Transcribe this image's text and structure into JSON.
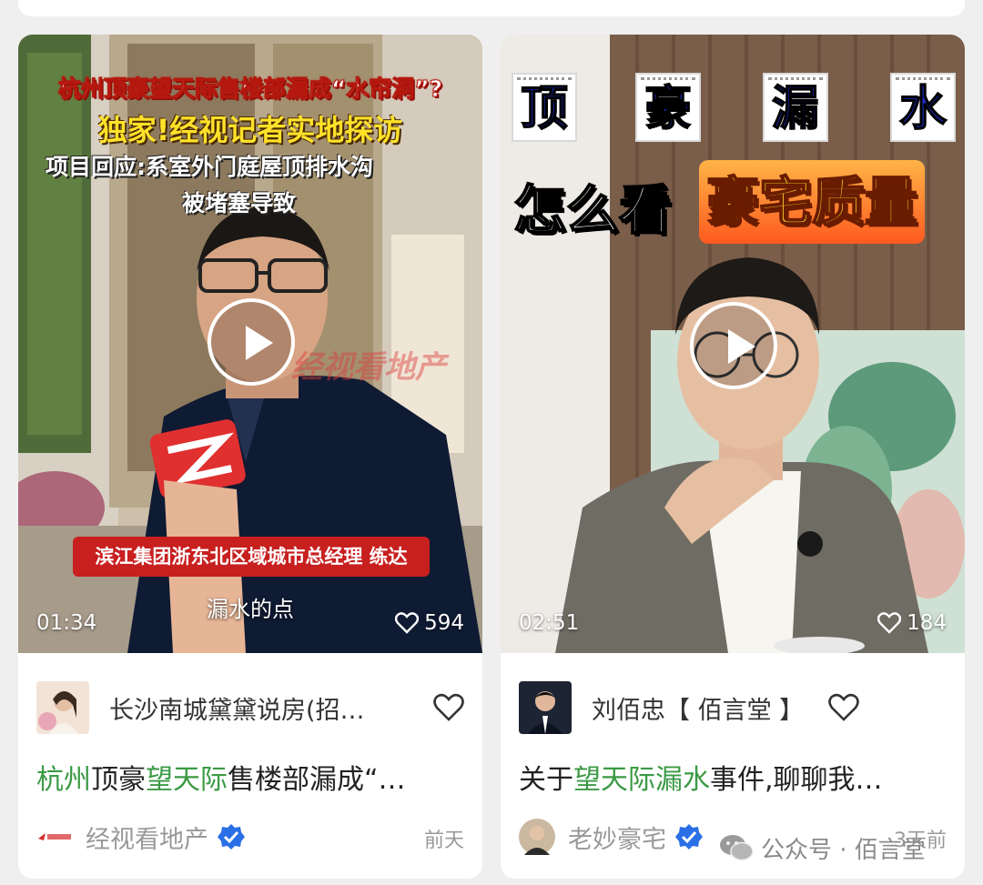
{
  "cards": [
    {
      "duration": "01:34",
      "likes": "594",
      "overlay": {
        "headline1": "杭州顶豪望天际售楼部漏成“水帘洞”?",
        "headline2": "独家!经视记者实地探访",
        "headline3": "项目回应:系室外门庭屋顶排水沟",
        "headline4": "被堵塞导致",
        "watermark": "经视看地产",
        "name_banner": "滨江集团浙东北区域城市总经理 练达",
        "subtitle": "漏水的点"
      },
      "author": "长沙南城黛黛说房(招…",
      "title_parts": [
        {
          "text": "杭州",
          "highlight": true
        },
        {
          "text": "顶豪",
          "highlight": false
        },
        {
          "text": "望天际",
          "highlight": true
        },
        {
          "text": "售楼部漏成“…",
          "highlight": false
        }
      ],
      "source": "经视看地产",
      "time": "前天"
    },
    {
      "duration": "02:51",
      "likes": "184",
      "overlay": {
        "tiles": [
          "顶",
          "豪",
          "漏",
          "水"
        ],
        "caption_left": "怎么看",
        "caption_right": "豪宅质量"
      },
      "author": "刘佰忠【 佰言堂 】",
      "title_parts": [
        {
          "text": "关于",
          "highlight": false
        },
        {
          "text": "望天际漏水",
          "highlight": true
        },
        {
          "text": "事件,聊聊我…",
          "highlight": false
        }
      ],
      "source": "老妙豪宅",
      "time": "3天前"
    }
  ],
  "footer_watermark": "公众号 · 佰言堂",
  "colors": {
    "highlight": "#3b9a44",
    "verified": "#2a6fe6",
    "banner_red": "#c81f1f",
    "tile_blue": "#1d2fd1"
  }
}
